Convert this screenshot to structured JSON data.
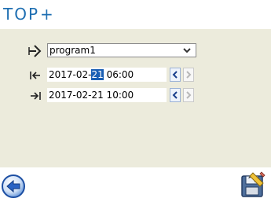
{
  "app": {
    "logo": "TOP",
    "logo_plus": "+"
  },
  "program": {
    "selected": "program1"
  },
  "start": {
    "date_prefix": "2017-02-",
    "day_highlighted": "21",
    "time_suffix": " 06:00"
  },
  "end": {
    "value": "2017-02-21 10:00"
  },
  "icons": {
    "program": "enter-arrow-icon",
    "start": "start-bar-icon",
    "end": "end-bar-icon",
    "back": "back-arrow-icon",
    "save": "save-icon"
  },
  "colors": {
    "brand": "#1f6fb2",
    "panel_bg": "#ecebdc",
    "selection": "#1a5fb4"
  }
}
